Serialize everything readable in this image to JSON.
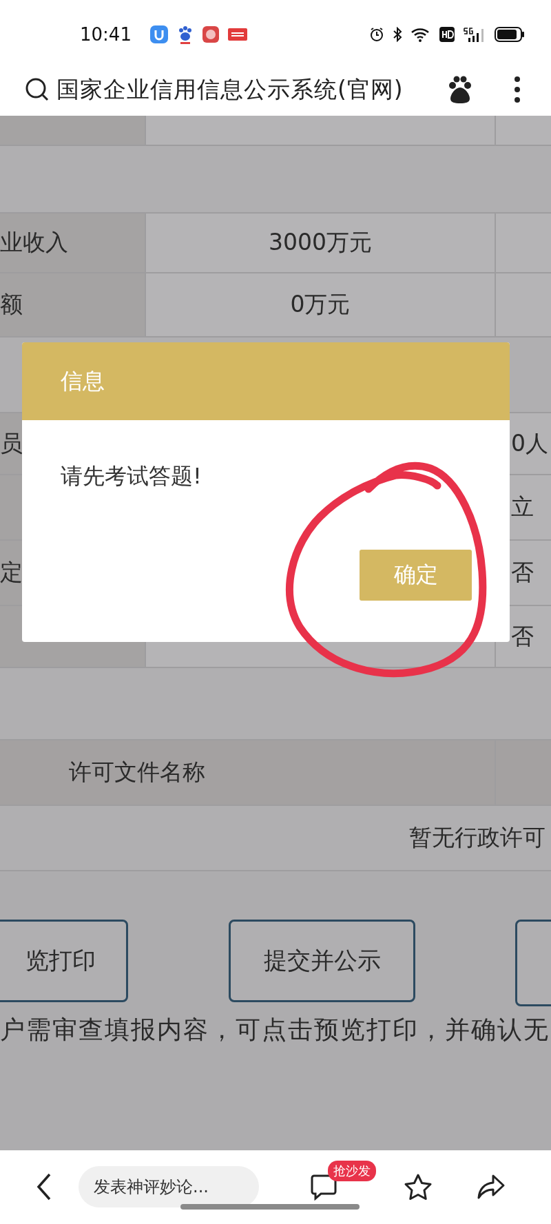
{
  "status_bar": {
    "time": "10:41"
  },
  "search_bar": {
    "query": "国家企业信用信息公示系统(官网)"
  },
  "table": {
    "rows": [
      {
        "kind": "data"
      },
      {
        "kind": "spacer"
      },
      {
        "kind": "data",
        "label": "业收入",
        "value": "3000万元"
      },
      {
        "kind": "data",
        "label": "额",
        "value": "0万元"
      },
      {
        "kind": "spacer"
      },
      {
        "kind": "data",
        "label": "员",
        "extra": "0人"
      },
      {
        "kind": "data",
        "extra": "立"
      },
      {
        "kind": "data",
        "label": "定",
        "extra": "否"
      },
      {
        "kind": "data",
        "extra": "否"
      },
      {
        "kind": "spacer"
      },
      {
        "kind": "header",
        "label": "许可文件名称"
      },
      {
        "kind": "notice",
        "value": "暂无行政许可"
      }
    ]
  },
  "action_buttons": [
    {
      "label": "览打印"
    },
    {
      "label": "提交并公示"
    }
  ],
  "note": "户需审查填报内容，可点击预览打印，并确认无",
  "dialog": {
    "title": "信息",
    "message": "请先考试答题!",
    "button": "确定"
  },
  "bottom_bar": {
    "comment_placeholder": "发表神评妙论...",
    "badge": "抢沙发"
  }
}
